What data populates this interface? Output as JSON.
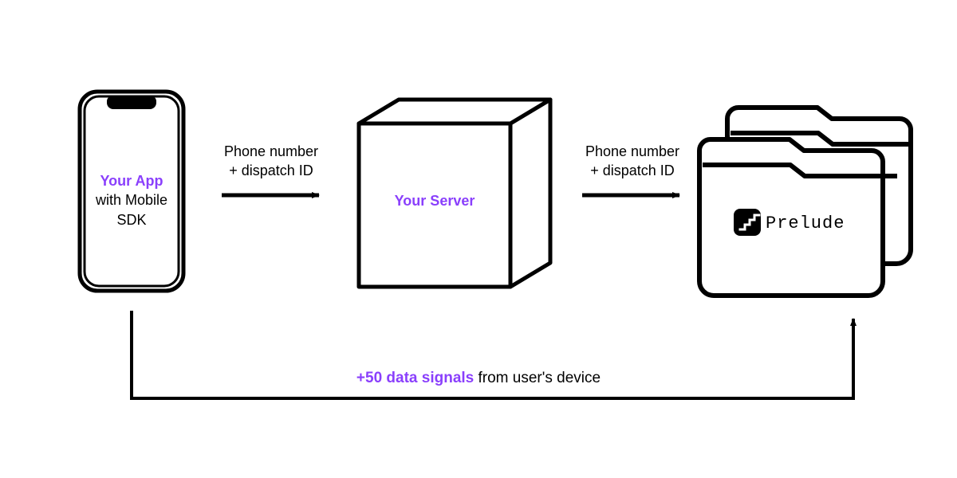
{
  "app": {
    "title": "Your App",
    "subtitle1": "with Mobile",
    "subtitle2": "SDK"
  },
  "server": {
    "title": "Your Server"
  },
  "prelude": {
    "label": "Prelude"
  },
  "arrow1": {
    "line1": "Phone number",
    "line2": "+ dispatch ID"
  },
  "arrow2": {
    "line1": "Phone number",
    "line2": "+ dispatch ID"
  },
  "signals": {
    "highlight": "+50 data signals",
    "rest": " from user's device"
  },
  "colors": {
    "accent": "#8a3ffc",
    "stroke": "#000000"
  }
}
